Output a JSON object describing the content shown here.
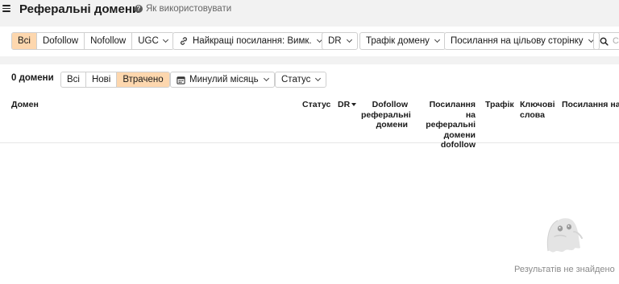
{
  "header": {
    "title": "Реферальні домени",
    "help_label": "Як використовувати"
  },
  "filters": {
    "link_type": {
      "options": [
        "Всі",
        "Dofollow",
        "Nofollow",
        "UGC"
      ],
      "active": "Всі"
    },
    "best_links": "Найкращі посилання: Вимк.",
    "dr": "DR",
    "domain_traffic": "Трафік домену",
    "target_links": "Посилання на цільову сторінку",
    "search_placeholder": "С"
  },
  "subbar": {
    "count": "0 домени",
    "status_tabs": [
      "Всі",
      "Нові",
      "Втрачено"
    ],
    "active_tab": "Втрачено",
    "period": "Минулий місяць",
    "status": "Статус"
  },
  "table": {
    "columns": [
      "Домен",
      "Статус",
      "DR",
      "Dofollow реферальні домени",
      "Посилання на реферальні домени dofollow",
      "Трафік",
      "Ключові слова",
      "Посилання на ц"
    ],
    "sorted_column": "DR"
  },
  "empty_state": {
    "message": "Результатів не знайдено"
  },
  "colors": {
    "active_tab_bg": "#fdd7ae",
    "page_bg": "#f2f2f2",
    "border": "#cfcfcf"
  }
}
